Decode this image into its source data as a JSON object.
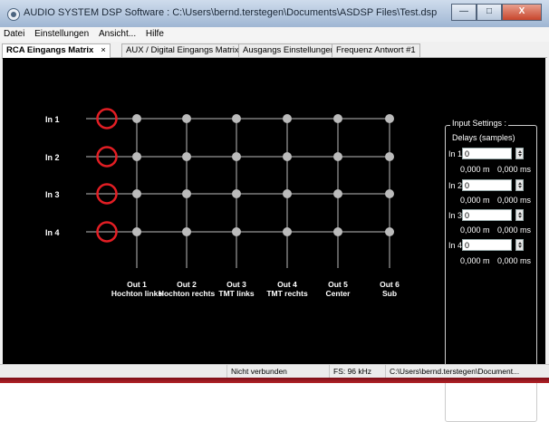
{
  "window": {
    "title": "AUDIO SYSTEM DSP Software : C:\\Users\\bernd.terstegen\\Documents\\ASDSP Files\\Test.dsp",
    "minimize": "—",
    "maximize": "□",
    "close": "X"
  },
  "menu": [
    "Datei",
    "Einstellungen",
    "Ansicht...",
    "Hilfe"
  ],
  "tabs": [
    {
      "label": "RCA Eingangs Matrix",
      "close": "×"
    },
    {
      "label": "AUX / Digital Eingangs Matrix"
    },
    {
      "label": "Ausgangs Einstellungen"
    },
    {
      "label": "Frequenz Antwort #1"
    }
  ],
  "matrix": {
    "inputs": [
      "In 1",
      "In 2",
      "In 3",
      "In 4"
    ],
    "outputs": [
      {
        "line1": "Out 1",
        "line2": "Hochton links"
      },
      {
        "line1": "Out 2",
        "line2": "Hochton rechts"
      },
      {
        "line1": "Out 3",
        "line2": "TMT links"
      },
      {
        "line1": "Out 4",
        "line2": "TMT rechts"
      },
      {
        "line1": "Out 5",
        "line2": "Center"
      },
      {
        "line1": "Out 6",
        "line2": "Sub"
      }
    ],
    "colors": {
      "ring": "#e31e24",
      "node": "#bbbbbb",
      "line": "#bbbbbb",
      "label": "#ffffff"
    }
  },
  "input_settings": {
    "title": "Input Settings :",
    "subtitle": "Delays (samples)",
    "channels": [
      {
        "label": "In 1",
        "value": "0",
        "meters": "0,000 m",
        "ms": "0,000 ms"
      },
      {
        "label": "In 2",
        "value": "0",
        "meters": "0,000 m",
        "ms": "0,000 ms"
      },
      {
        "label": "In 3",
        "value": "0",
        "meters": "0,000 m",
        "ms": "0,000 ms"
      },
      {
        "label": "In 4",
        "value": "0",
        "meters": "0,000 m",
        "ms": "0,000 ms"
      }
    ]
  },
  "status": {
    "connection": "Nicht verbunden",
    "sample_rate": "FS: 96 kHz",
    "path": "C:\\Users\\bernd.terstegen\\Document..."
  }
}
